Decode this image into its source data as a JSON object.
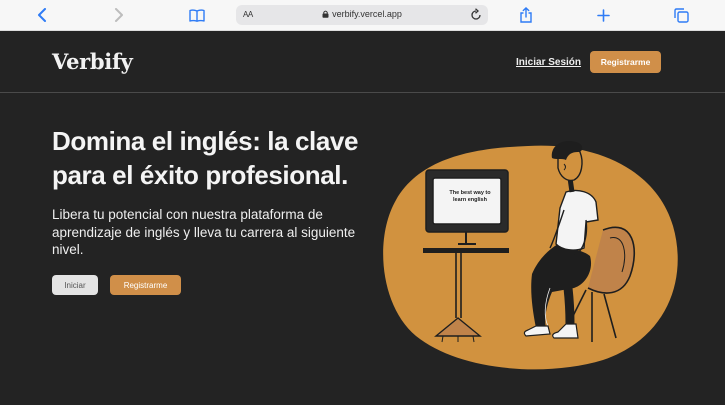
{
  "browser": {
    "url": "verbify.vercel.app",
    "text_size_label": "AA"
  },
  "site": {
    "brand": "Verbify",
    "nav": {
      "login_label": "Iniciar Sesión",
      "register_label": "Registrarme"
    }
  },
  "hero": {
    "title": "Domina el inglés: la clave para el éxito profesional.",
    "subtitle": "Libera tu potencial con nuestra plataforma de aprendizaje de inglés y lleva tu carrera al siguiente nivel.",
    "start_label": "Iniciar",
    "register_label": "Registrarme",
    "monitor_text": "The best way to learn english"
  },
  "colors": {
    "background": "#232323",
    "accent": "#d08f49",
    "blob": "#d1923f"
  }
}
